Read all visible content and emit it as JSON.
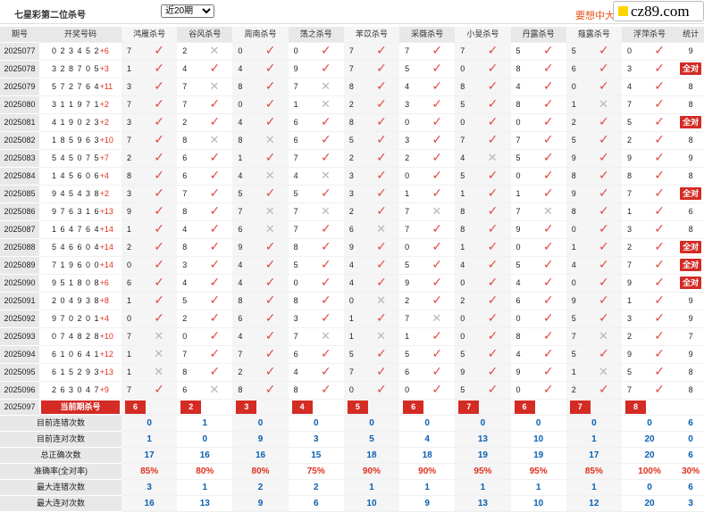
{
  "header": {
    "title": "七星彩第二位杀号",
    "period_selected": "近20期",
    "promo": "要想中大",
    "logo": "cz89.com"
  },
  "columns": {
    "issue": "期号",
    "draw": "开奖号码",
    "experts": [
      "鸿雁杀号",
      "谷风杀号",
      "周南杀号",
      "荡之杀号",
      "苯苡杀号",
      "采薇杀号",
      "小旻杀号",
      "丹露杀号",
      "薤露杀号",
      "浮萍杀号"
    ],
    "summary": "统计"
  },
  "rows": [
    {
      "issue": "2025077",
      "draw": "0 2 3 4 5 2",
      "plus": "+6",
      "picks": [
        [
          "7",
          1
        ],
        [
          "2",
          0
        ],
        [
          "0",
          1
        ],
        [
          "0",
          1
        ],
        [
          "7",
          1
        ],
        [
          "7",
          1
        ],
        [
          "7",
          1
        ],
        [
          "5",
          1
        ],
        [
          "5",
          1
        ],
        [
          "0",
          1
        ]
      ],
      "sum": "9",
      "all": false
    },
    {
      "issue": "2025078",
      "draw": "3 2 8 7 0 5",
      "plus": "+3",
      "picks": [
        [
          "1",
          1
        ],
        [
          "4",
          1
        ],
        [
          "4",
          1
        ],
        [
          "9",
          1
        ],
        [
          "7",
          1
        ],
        [
          "5",
          1
        ],
        [
          "0",
          1
        ],
        [
          "8",
          1
        ],
        [
          "6",
          1
        ],
        [
          "3",
          1
        ]
      ],
      "sum": "全对",
      "all": true
    },
    {
      "issue": "2025079",
      "draw": "5 7 2 7 6 4",
      "plus": "+11",
      "picks": [
        [
          "3",
          1
        ],
        [
          "7",
          0
        ],
        [
          "8",
          1
        ],
        [
          "7",
          0
        ],
        [
          "8",
          1
        ],
        [
          "4",
          1
        ],
        [
          "8",
          1
        ],
        [
          "4",
          1
        ],
        [
          "0",
          1
        ],
        [
          "4",
          1
        ]
      ],
      "sum": "8",
      "all": false
    },
    {
      "issue": "2025080",
      "draw": "3 1 1 9 7 1",
      "plus": "+2",
      "picks": [
        [
          "7",
          1
        ],
        [
          "7",
          1
        ],
        [
          "0",
          1
        ],
        [
          "1",
          0
        ],
        [
          "2",
          1
        ],
        [
          "3",
          1
        ],
        [
          "5",
          1
        ],
        [
          "8",
          1
        ],
        [
          "1",
          0
        ],
        [
          "7",
          1
        ]
      ],
      "sum": "8",
      "all": false
    },
    {
      "issue": "2025081",
      "draw": "4 1 9 0 2 3",
      "plus": "+2",
      "picks": [
        [
          "3",
          1
        ],
        [
          "2",
          1
        ],
        [
          "4",
          1
        ],
        [
          "6",
          1
        ],
        [
          "8",
          1
        ],
        [
          "0",
          1
        ],
        [
          "0",
          1
        ],
        [
          "0",
          1
        ],
        [
          "2",
          1
        ],
        [
          "5",
          1
        ]
      ],
      "sum": "全对",
      "all": true
    },
    {
      "issue": "2025082",
      "draw": "1 8 5 9 6 3",
      "plus": "+10",
      "picks": [
        [
          "7",
          1
        ],
        [
          "8",
          0
        ],
        [
          "8",
          0
        ],
        [
          "6",
          1
        ],
        [
          "5",
          1
        ],
        [
          "3",
          1
        ],
        [
          "7",
          1
        ],
        [
          "7",
          1
        ],
        [
          "5",
          1
        ],
        [
          "2",
          1
        ]
      ],
      "sum": "8",
      "all": false
    },
    {
      "issue": "2025083",
      "draw": "5 4 5 0 7 5",
      "plus": "+7",
      "picks": [
        [
          "2",
          1
        ],
        [
          "6",
          1
        ],
        [
          "1",
          1
        ],
        [
          "7",
          1
        ],
        [
          "2",
          1
        ],
        [
          "2",
          1
        ],
        [
          "4",
          0
        ],
        [
          "5",
          1
        ],
        [
          "9",
          1
        ],
        [
          "9",
          1
        ]
      ],
      "sum": "9",
      "all": false
    },
    {
      "issue": "2025084",
      "draw": "1 4 5 6 0 6",
      "plus": "+4",
      "picks": [
        [
          "8",
          1
        ],
        [
          "6",
          1
        ],
        [
          "4",
          0
        ],
        [
          "4",
          0
        ],
        [
          "3",
          1
        ],
        [
          "0",
          1
        ],
        [
          "5",
          1
        ],
        [
          "0",
          1
        ],
        [
          "8",
          1
        ],
        [
          "8",
          1
        ]
      ],
      "sum": "8",
      "all": false
    },
    {
      "issue": "2025085",
      "draw": "9 4 5 4 3 8",
      "plus": "+2",
      "picks": [
        [
          "3",
          1
        ],
        [
          "7",
          1
        ],
        [
          "5",
          1
        ],
        [
          "5",
          1
        ],
        [
          "3",
          1
        ],
        [
          "1",
          1
        ],
        [
          "1",
          1
        ],
        [
          "1",
          1
        ],
        [
          "9",
          1
        ],
        [
          "7",
          1
        ]
      ],
      "sum": "全对",
      "all": true
    },
    {
      "issue": "2025086",
      "draw": "9 7 6 3 1 6",
      "plus": "+13",
      "picks": [
        [
          "9",
          1
        ],
        [
          "8",
          1
        ],
        [
          "7",
          0
        ],
        [
          "7",
          0
        ],
        [
          "2",
          1
        ],
        [
          "7",
          0
        ],
        [
          "8",
          1
        ],
        [
          "7",
          0
        ],
        [
          "8",
          1
        ],
        [
          "1",
          1
        ]
      ],
      "sum": "6",
      "all": false
    },
    {
      "issue": "2025087",
      "draw": "1 6 4 7 6 4",
      "plus": "+14",
      "picks": [
        [
          "1",
          1
        ],
        [
          "4",
          1
        ],
        [
          "6",
          0
        ],
        [
          "7",
          1
        ],
        [
          "6",
          0
        ],
        [
          "7",
          1
        ],
        [
          "8",
          1
        ],
        [
          "9",
          1
        ],
        [
          "0",
          1
        ],
        [
          "3",
          1
        ]
      ],
      "sum": "8",
      "all": false
    },
    {
      "issue": "2025088",
      "draw": "5 4 6 6 0 4",
      "plus": "+14",
      "picks": [
        [
          "2",
          1
        ],
        [
          "8",
          1
        ],
        [
          "9",
          1
        ],
        [
          "8",
          1
        ],
        [
          "9",
          1
        ],
        [
          "0",
          1
        ],
        [
          "1",
          1
        ],
        [
          "0",
          1
        ],
        [
          "1",
          1
        ],
        [
          "2",
          1
        ]
      ],
      "sum": "全对",
      "all": true
    },
    {
      "issue": "2025089",
      "draw": "7 1 9 6 0 0",
      "plus": "+14",
      "picks": [
        [
          "0",
          1
        ],
        [
          "3",
          1
        ],
        [
          "4",
          1
        ],
        [
          "5",
          1
        ],
        [
          "4",
          1
        ],
        [
          "5",
          1
        ],
        [
          "4",
          1
        ],
        [
          "5",
          1
        ],
        [
          "4",
          1
        ],
        [
          "7",
          1
        ]
      ],
      "sum": "全对",
      "all": true
    },
    {
      "issue": "2025090",
      "draw": "9 5 1 8 0 8",
      "plus": "+6",
      "picks": [
        [
          "6",
          1
        ],
        [
          "4",
          1
        ],
        [
          "4",
          1
        ],
        [
          "0",
          1
        ],
        [
          "4",
          1
        ],
        [
          "9",
          1
        ],
        [
          "0",
          1
        ],
        [
          "4",
          1
        ],
        [
          "0",
          1
        ],
        [
          "9",
          1
        ]
      ],
      "sum": "全对",
      "all": true
    },
    {
      "issue": "2025091",
      "draw": "2 0 4 9 3 8",
      "plus": "+8",
      "picks": [
        [
          "1",
          1
        ],
        [
          "5",
          1
        ],
        [
          "8",
          1
        ],
        [
          "8",
          1
        ],
        [
          "0",
          0
        ],
        [
          "2",
          1
        ],
        [
          "2",
          1
        ],
        [
          "6",
          1
        ],
        [
          "9",
          1
        ],
        [
          "1",
          1
        ]
      ],
      "sum": "9",
      "all": false
    },
    {
      "issue": "2025092",
      "draw": "9 7 0 2 0 1",
      "plus": "+4",
      "picks": [
        [
          "0",
          1
        ],
        [
          "2",
          1
        ],
        [
          "6",
          1
        ],
        [
          "3",
          1
        ],
        [
          "1",
          1
        ],
        [
          "7",
          0
        ],
        [
          "0",
          1
        ],
        [
          "0",
          1
        ],
        [
          "5",
          1
        ],
        [
          "3",
          1
        ]
      ],
      "sum": "9",
      "all": false
    },
    {
      "issue": "2025093",
      "draw": "0 7 4 8 2 8",
      "plus": "+10",
      "picks": [
        [
          "7",
          0
        ],
        [
          "0",
          1
        ],
        [
          "4",
          1
        ],
        [
          "7",
          0
        ],
        [
          "1",
          0
        ],
        [
          "1",
          1
        ],
        [
          "0",
          1
        ],
        [
          "8",
          1
        ],
        [
          "7",
          0
        ],
        [
          "2",
          1
        ]
      ],
      "sum": "7",
      "all": false
    },
    {
      "issue": "2025094",
      "draw": "6 1 0 6 4 1",
      "plus": "+12",
      "picks": [
        [
          "1",
          0
        ],
        [
          "7",
          1
        ],
        [
          "7",
          1
        ],
        [
          "6",
          1
        ],
        [
          "5",
          1
        ],
        [
          "5",
          1
        ],
        [
          "5",
          1
        ],
        [
          "4",
          1
        ],
        [
          "5",
          1
        ],
        [
          "9",
          1
        ]
      ],
      "sum": "9",
      "all": false
    },
    {
      "issue": "2025095",
      "draw": "6 1 5 2 9 3",
      "plus": "+13",
      "picks": [
        [
          "1",
          0
        ],
        [
          "8",
          1
        ],
        [
          "2",
          1
        ],
        [
          "4",
          1
        ],
        [
          "7",
          1
        ],
        [
          "6",
          1
        ],
        [
          "9",
          1
        ],
        [
          "9",
          1
        ],
        [
          "1",
          0
        ],
        [
          "5",
          1
        ]
      ],
      "sum": "8",
      "all": false
    },
    {
      "issue": "2025096",
      "draw": "2 6 3 0 4 7",
      "plus": "+9",
      "picks": [
        [
          "7",
          1
        ],
        [
          "6",
          0
        ],
        [
          "8",
          1
        ],
        [
          "8",
          1
        ],
        [
          "0",
          1
        ],
        [
          "0",
          1
        ],
        [
          "5",
          1
        ],
        [
          "0",
          1
        ],
        [
          "2",
          1
        ],
        [
          "7",
          1
        ]
      ],
      "sum": "8",
      "all": false
    }
  ],
  "current": {
    "issue": "2025097",
    "label": "当前期杀号",
    "picks": [
      "6",
      "2",
      "3",
      "4",
      "5",
      "6",
      "7",
      "6",
      "7",
      "8"
    ]
  },
  "stats": [
    {
      "label": "目前连错次数",
      "values": [
        "0",
        "1",
        "0",
        "0",
        "0",
        "0",
        "0",
        "0",
        "0",
        "0",
        "6"
      ]
    },
    {
      "label": "目前连对次数",
      "values": [
        "1",
        "0",
        "9",
        "3",
        "5",
        "4",
        "13",
        "10",
        "1",
        "20",
        "0"
      ]
    },
    {
      "label": "总正确次数",
      "values": [
        "17",
        "16",
        "16",
        "15",
        "18",
        "18",
        "19",
        "19",
        "17",
        "20",
        "6"
      ]
    },
    {
      "label": "准确率(全对率)",
      "values": [
        "85%",
        "80%",
        "80%",
        "75%",
        "90%",
        "90%",
        "95%",
        "95%",
        "85%",
        "100%",
        "30%"
      ],
      "pct": true
    },
    {
      "label": "最大连错次数",
      "values": [
        "3",
        "1",
        "2",
        "2",
        "1",
        "1",
        "1",
        "1",
        "1",
        "0",
        "6"
      ]
    },
    {
      "label": "最大连对次数",
      "values": [
        "16",
        "13",
        "9",
        "6",
        "10",
        "9",
        "13",
        "10",
        "12",
        "20",
        "3"
      ]
    }
  ]
}
